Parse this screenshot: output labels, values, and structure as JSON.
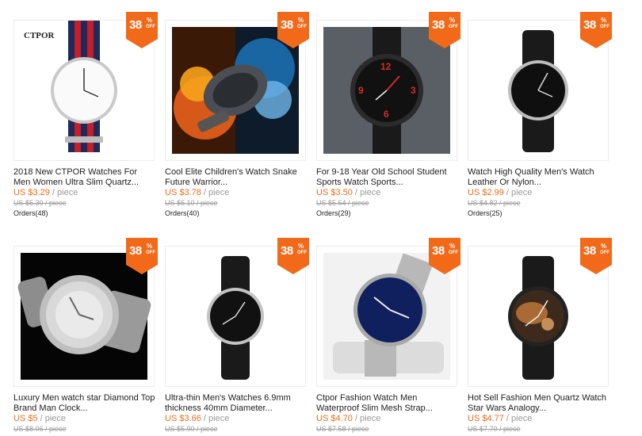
{
  "badge": {
    "number": "38",
    "percent": "%",
    "off": "OFF"
  },
  "products": [
    {
      "title": "2018 New CTPOR Watches For Men Women Ultra Slim Quartz...",
      "price": "US $3.29",
      "unit": " / piece",
      "old_price": "US $5.30 / piece",
      "orders": "Orders(48)",
      "brand_text": "CTPOR",
      "image": "white-dial-striped-strap-watch"
    },
    {
      "title": "Cool Elite Children's Watch Snake Future Warrior...",
      "price": "US $3.78",
      "unit": " / piece",
      "old_price": "US $6.10 / piece",
      "orders": "Orders(40)",
      "image": "fire-water-sport-watch"
    },
    {
      "title": "For 9-18 Year Old School Student Sports Watch Sports...",
      "price": "US $3.50",
      "unit": " / piece",
      "old_price": "US $5.64 / piece",
      "orders": "Orders(29)",
      "image": "red-numeral-black-watch"
    },
    {
      "title": "Watch High Quality Men's Watch Leather Or Nylon...",
      "price": "US $2.99",
      "unit": " / piece",
      "old_price": "US $4.82 / piece",
      "orders": "Orders(25)",
      "image": "minimal-black-watch"
    },
    {
      "title": "Luxury Men watch star Diamond Top Brand Man Clock...",
      "price": "US $5",
      "unit": " / piece",
      "old_price": "US $8.06 / piece",
      "orders": "",
      "image": "diamond-silver-watch"
    },
    {
      "title": "Ultra-thin Men's Watches 6.9mm thickness 40mm Diameter...",
      "price": "US $3.66",
      "unit": " / piece",
      "old_price": "US $5.90 / piece",
      "orders": "",
      "image": "ultra-thin-black-watch"
    },
    {
      "title": "Ctpor Fashion Watch Men Waterproof Slim Mesh Strap...",
      "price": "US $4.70",
      "unit": " / piece",
      "old_price": "US $7.58 / piece",
      "orders": "",
      "image": "blue-dial-mesh-watch"
    },
    {
      "title": "Hot Sell Fashion Men Quartz Watch Star Wars Analogy...",
      "price": "US $4.77",
      "unit": " / piece",
      "old_price": "US $7.70 / piece",
      "orders": "",
      "image": "star-wars-dial-watch"
    }
  ],
  "colors": {
    "accent": "#f26a19",
    "badge": "#f26a19",
    "muted": "#999999",
    "text": "#222222"
  }
}
